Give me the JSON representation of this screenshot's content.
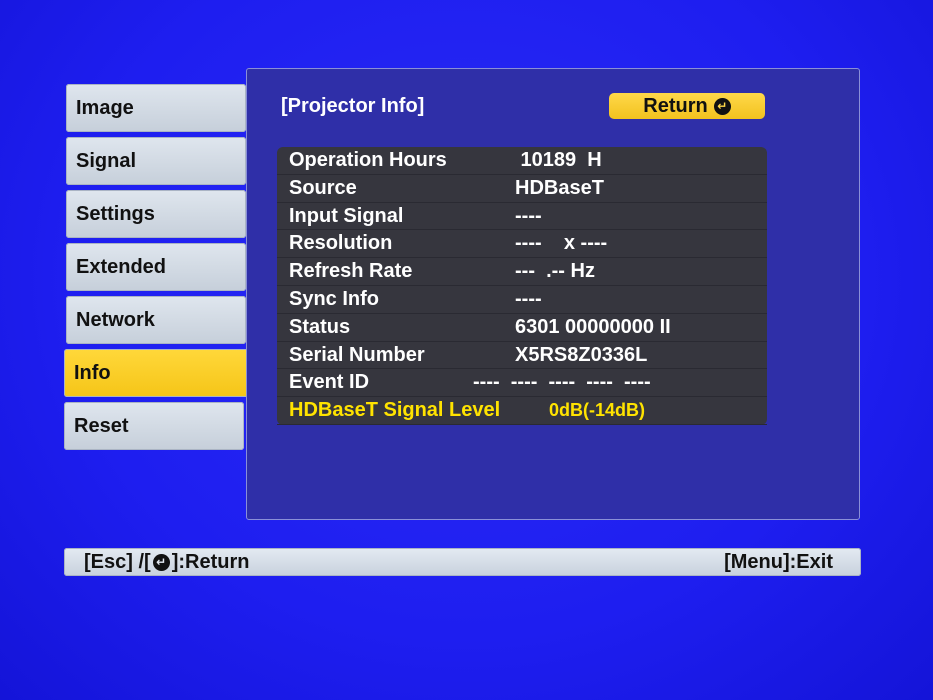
{
  "menu": {
    "items": [
      {
        "label": "Image"
      },
      {
        "label": "Signal"
      },
      {
        "label": "Settings"
      },
      {
        "label": "Extended"
      },
      {
        "label": "Network"
      },
      {
        "label": "Info"
      },
      {
        "label": "Reset"
      }
    ],
    "active_index": 5
  },
  "panel": {
    "title": "[Projector Info]",
    "return_label": "Return",
    "return_icon": "enter-icon"
  },
  "info": {
    "rows": [
      {
        "key": "Operation Hours",
        "value": " 10189  H"
      },
      {
        "key": "Source",
        "value": "HDBaseT"
      },
      {
        "key": "Input Signal",
        "value": "----"
      },
      {
        "key": "Resolution",
        "value": "----    x ----"
      },
      {
        "key": "Refresh Rate",
        "value": "---  .-- Hz"
      },
      {
        "key": "Sync Info",
        "value": "----"
      },
      {
        "key": "Status",
        "value": "6301 00000000 II"
      },
      {
        "key": "Serial Number",
        "value": "X5RS8Z0336L"
      },
      {
        "key": "Event ID",
        "value": "----  ----  ----  ----  ----"
      },
      {
        "key": "HDBaseT Signal Level",
        "value": "0dB(-14dB)"
      }
    ]
  },
  "footer": {
    "left_prefix": "[Esc] /[",
    "left_suffix": "]:Return",
    "right": "[Menu]:Exit"
  },
  "colors": {
    "background": "#1e1ef0",
    "highlight": "#f5c518",
    "highlight_text": "#ffe300",
    "panel": "#2f2fa8",
    "table": "#36363e"
  }
}
